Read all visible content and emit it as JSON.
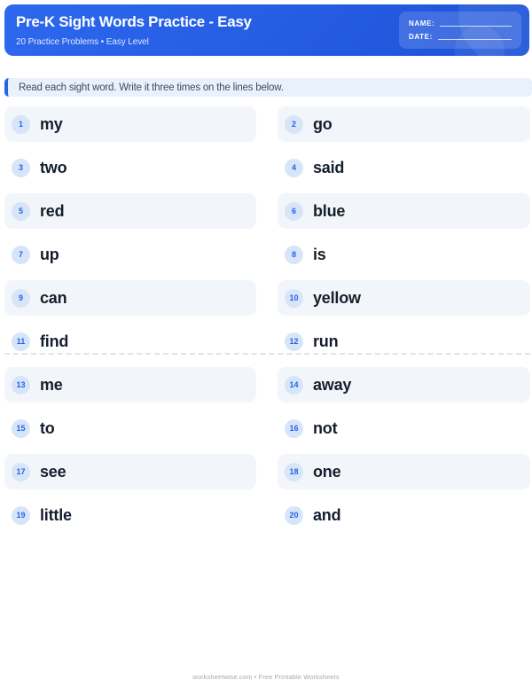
{
  "header": {
    "title": "Pre-K Sight Words Practice - Easy",
    "subtitle": "20 Practice Problems • Easy Level",
    "name_label": "NAME:",
    "date_label": "DATE:"
  },
  "instruction": "Read each sight word. Write it three times on the lines below.",
  "words": [
    {
      "num": "1",
      "word": "my"
    },
    {
      "num": "2",
      "word": "go"
    },
    {
      "num": "3",
      "word": "two"
    },
    {
      "num": "4",
      "word": "said"
    },
    {
      "num": "5",
      "word": "red"
    },
    {
      "num": "6",
      "word": "blue"
    },
    {
      "num": "7",
      "word": "up"
    },
    {
      "num": "8",
      "word": "is"
    },
    {
      "num": "9",
      "word": "can"
    },
    {
      "num": "10",
      "word": "yellow"
    },
    {
      "num": "11",
      "word": "find"
    },
    {
      "num": "12",
      "word": "run"
    },
    {
      "num": "13",
      "word": "me"
    },
    {
      "num": "14",
      "word": "away"
    },
    {
      "num": "15",
      "word": "to"
    },
    {
      "num": "16",
      "word": "not"
    },
    {
      "num": "17",
      "word": "see"
    },
    {
      "num": "18",
      "word": "one"
    },
    {
      "num": "19",
      "word": "little"
    },
    {
      "num": "20",
      "word": "and"
    }
  ],
  "footer": "worksheetwise.com • Free Printable Worksheets",
  "colors": {
    "header_blue": "#2d68ee",
    "header_blue_dark": "#1d52d8",
    "accent_blue": "#2563eb",
    "instruction_bg": "#e9f1fc",
    "item_bg": "#f2f6fb",
    "badge_bg": "#d7e5f8",
    "badge_text": "#2563eb",
    "word_text": "#151e2d",
    "footer_text": "#a7a9ac"
  }
}
